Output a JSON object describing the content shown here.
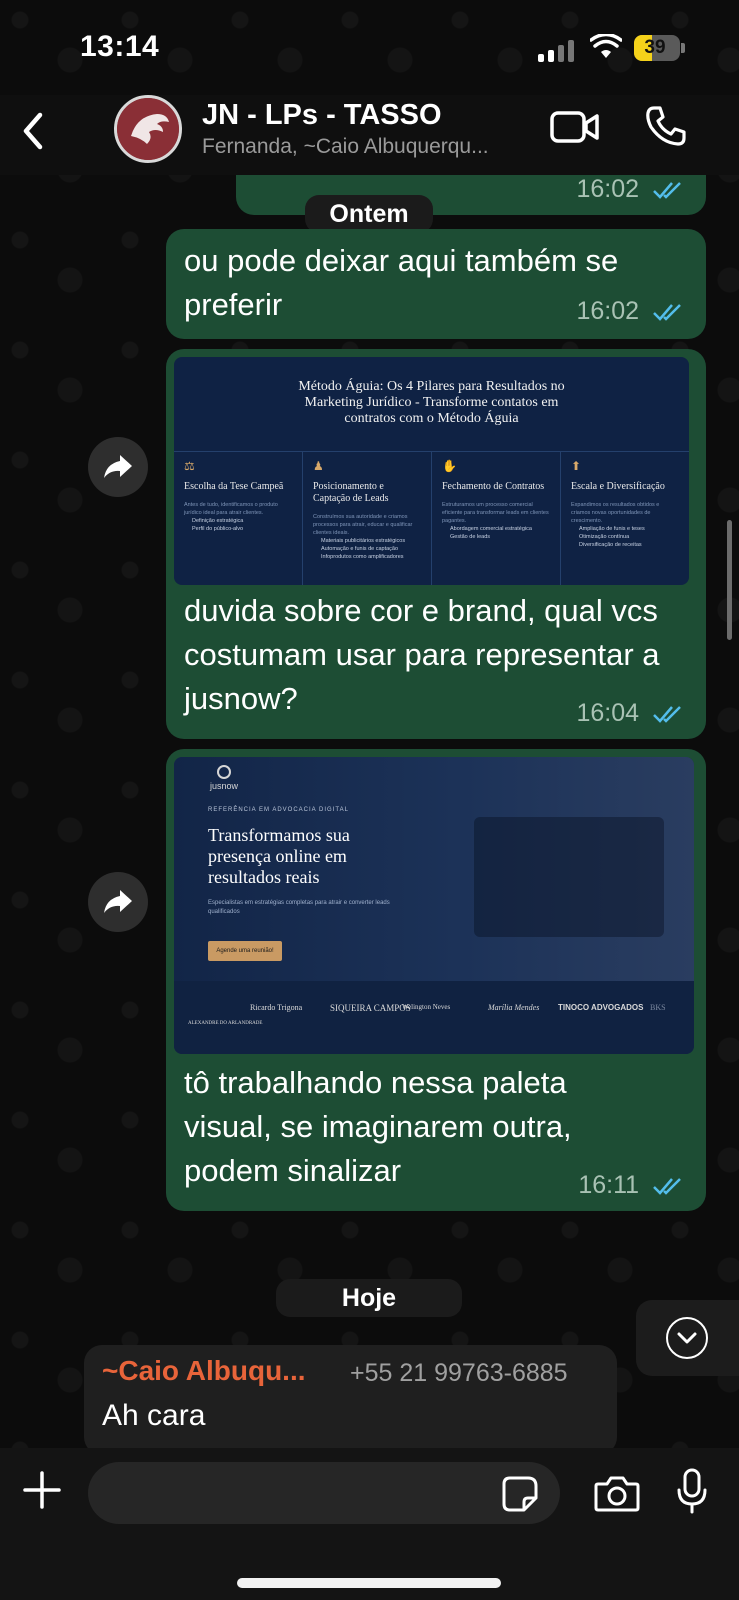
{
  "status": {
    "time": "13:14",
    "battery": "39",
    "battery_level": 0.39
  },
  "header": {
    "title": "JN - LPs - TASSO",
    "subtitle": "Fernanda, ~Caio Albuquerqu..."
  },
  "dates": {
    "yesterday": "Ontem",
    "today": "Hoje"
  },
  "messages": [
    {
      "time": "16:02"
    },
    {
      "text": "ou pode deixar aqui também se preferir",
      "time": "16:02"
    },
    {
      "text": "duvida sobre cor e brand, qual vcs costumam usar para representar a jusnow?",
      "time": "16:04"
    },
    {
      "text": "tô trabalhando nessa paleta visual, se imaginarem outra, podem sinalizar",
      "time": "16:11"
    }
  ],
  "image1": {
    "title": "Método Águia: Os 4 Pilares para Resultados no Marketing Jurídico - Transforme contatos em contratos com o Método Águia",
    "pillars": [
      {
        "title": "Escolha da Tese Campeã",
        "body": "Antes de tudo, identificamos o produto jurídico ideal para atrair clientes.",
        "items": [
          "Definição estratégica",
          "Perfil do público-alvo"
        ]
      },
      {
        "title": "Posicionamento e Captação de Leads",
        "body": "Construímos sua autoridade e criamos processos para atrair, educar e qualificar clientes ideais.",
        "items": [
          "Materiais publicitários estratégicos",
          "Automação e funis de captação",
          "Infoprodutos como amplificadores"
        ]
      },
      {
        "title": "Fechamento de Contratos",
        "body": "Estruturamos um processo comercial eficiente para transformar leads em clientes pagantes.",
        "items": [
          "Abordagem comercial estratégica",
          "Gestão de leads"
        ]
      },
      {
        "title": "Escala e Diversificação",
        "body": "Expandimos os resultados obtidos e criamos novas oportunidades de crescimento.",
        "items": [
          "Ampliação de funis e teses",
          "Otimização contínua",
          "Diversificação de receitas"
        ]
      }
    ]
  },
  "image2": {
    "logo": "jusnow",
    "kicker": "REFERÊNCIA EM ADVOCACIA DIGITAL",
    "headline": "Transformamos sua presença online em resultados reais",
    "sub": "Especialistas em estratégias completas para atrair e converter leads qualificados",
    "cta": "Agende uma reunião!",
    "clients": [
      "ALEXANDRE DO ARLANDRADE",
      "Ricardo Trigona",
      "SIQUEIRA CAMPOS",
      "Welington Neves",
      "Marília Mendes",
      "TINOCO ADVOGADOS",
      "BKS"
    ]
  },
  "incoming": {
    "sender": "~Caio Albuqu...",
    "phone": "+55 21 99763-6885",
    "text": "Ah cara"
  },
  "composer": {
    "placeholder": ""
  }
}
